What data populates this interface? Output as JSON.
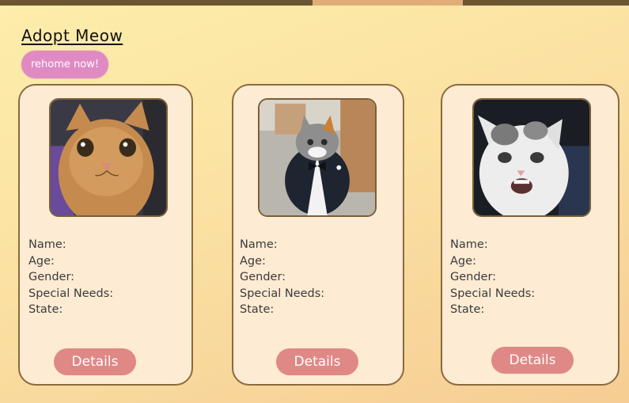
{
  "header": {
    "title": "Adopt Meow",
    "rehome_label": "rehome now!"
  },
  "cards": [
    {
      "image_alt": "orange tabby cat photo",
      "fields": [
        "Name:",
        "Age:",
        "Gender:",
        "Special Needs:",
        "State:"
      ],
      "details_label": "Details"
    },
    {
      "image_alt": "calico cat in tuxedo costume photo",
      "fields": [
        "Name:",
        "Age:",
        "Gender:",
        "Special Needs:",
        "State:"
      ],
      "details_label": "Details"
    },
    {
      "image_alt": "white and grey kitten photo",
      "fields": [
        "Name:",
        "Age:",
        "Gender:",
        "Special Needs:",
        "State:"
      ],
      "details_label": "Details"
    }
  ],
  "colors": {
    "background": "#fbe1a3",
    "card_bg": "#fdebd3",
    "card_border": "#8a6a3e",
    "rehome_button": "#e08ac4",
    "details_button": "#df8886",
    "topbar": "#6b5631"
  }
}
